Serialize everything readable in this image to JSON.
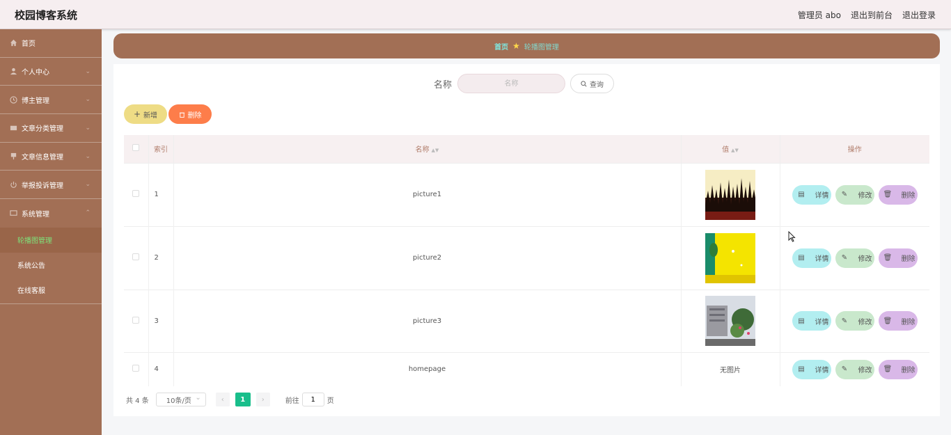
{
  "header": {
    "brand": "校园博客系统",
    "user": "管理员 abo",
    "to_front": "退出到前台",
    "logout": "退出登录"
  },
  "sidebar": {
    "items": [
      {
        "label": "首页",
        "icon": "home-icon",
        "chevron": false
      },
      {
        "label": "个人中心",
        "icon": "user-icon",
        "chevron": true
      },
      {
        "label": "博主管理",
        "icon": "clock-icon",
        "chevron": true
      },
      {
        "label": "文章分类管理",
        "icon": "card-icon",
        "chevron": true
      },
      {
        "label": "文章信息管理",
        "icon": "pin-icon",
        "chevron": true
      },
      {
        "label": "举报投诉管理",
        "icon": "power-icon",
        "chevron": true
      },
      {
        "label": "系统管理",
        "icon": "chat-icon",
        "chevron": true,
        "expanded": true
      }
    ],
    "sub_items": [
      {
        "label": "轮播图管理",
        "active": true
      },
      {
        "label": "系统公告",
        "active": false
      },
      {
        "label": "在线客服",
        "active": false
      }
    ]
  },
  "breadcrumb": {
    "home": "首页",
    "current": "轮播图管理"
  },
  "search": {
    "label": "名称",
    "placeholder": "名称",
    "button": "查询"
  },
  "actions": {
    "add": "新增",
    "delete": "删除"
  },
  "table": {
    "headers": {
      "index": "索引",
      "name": "名称",
      "value": "值",
      "ops": "操作"
    },
    "rows": [
      {
        "index": "1",
        "name": "picture1",
        "value": "",
        "image": "grass"
      },
      {
        "index": "2",
        "name": "picture2",
        "value": "",
        "image": "yellow"
      },
      {
        "index": "3",
        "name": "picture3",
        "value": "",
        "image": "building"
      },
      {
        "index": "4",
        "name": "homepage",
        "value": "无图片",
        "image": ""
      }
    ],
    "ops": {
      "detail": "详情",
      "edit": "修改",
      "delete": "删除"
    }
  },
  "pager": {
    "total": "共 4 条",
    "size": "10条/页",
    "page": "1",
    "goto_prefix": "前往",
    "goto_value": "1",
    "goto_suffix": "页"
  },
  "colors": {
    "sidebar": "#a26f55",
    "accent_green": "#19be8b",
    "active_text": "#7ee27a"
  }
}
